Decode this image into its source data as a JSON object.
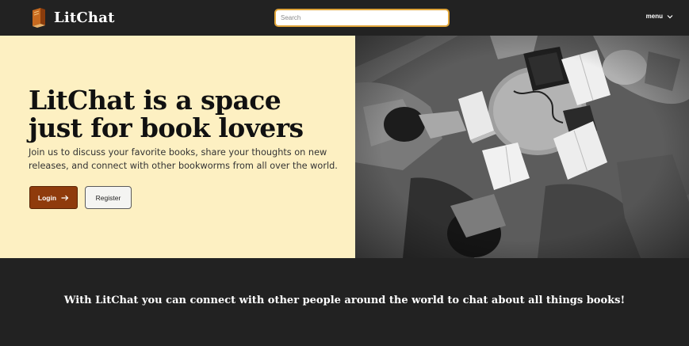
{
  "nav": {
    "brand": "LitChat",
    "search_placeholder": "Search",
    "menu_label": "menu",
    "icons": {
      "logo": "book-icon",
      "menu_arrow": "chevron-down-icon"
    }
  },
  "hero": {
    "headline_line1": "LitChat is a space",
    "headline_line2": "just for book lovers",
    "subtext": "Join us to discuss your favorite books, share your thoughts on new releases, and connect with other bookworms from all over the world.",
    "login_label": "Login",
    "register_label": "Register",
    "login_icon": "arrow-right-icon",
    "image": "photo of people reading books around a table"
  },
  "footer": {
    "tagline": "With LitChat you can connect with other people around the world to chat about all things books!"
  },
  "colors": {
    "nav_bg": "#222222",
    "hero_bg": "#fdf0c2",
    "accent": "#8f3b0c",
    "search_border": "#e0a53a"
  }
}
